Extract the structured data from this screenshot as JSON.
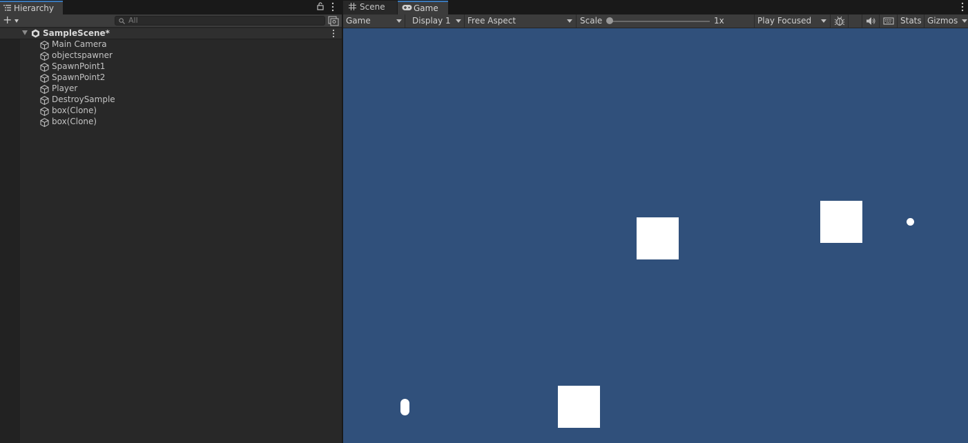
{
  "hierarchy": {
    "tab_label": "Hierarchy",
    "search_placeholder": "All",
    "add_label": "+",
    "scene": {
      "name": "SampleScene*"
    },
    "items": [
      {
        "label": "Main Camera"
      },
      {
        "label": "objectspawner"
      },
      {
        "label": "SpawnPoint1"
      },
      {
        "label": "SpawnPoint2"
      },
      {
        "label": "Player"
      },
      {
        "label": "DestroySample"
      },
      {
        "label": "box(Clone)"
      },
      {
        "label": "box(Clone)"
      }
    ]
  },
  "game": {
    "tabs": [
      {
        "label": "Scene",
        "icon": "grid-icon",
        "active": false
      },
      {
        "label": "Game",
        "icon": "gamepad-icon",
        "active": true
      }
    ],
    "toolbar": {
      "view_select": "Game",
      "display_select": "Display 1",
      "aspect_select": "Free Aspect",
      "scale_label": "Scale",
      "scale_value": "1x",
      "play_mode_select": "Play Focused",
      "stats_label": "Stats",
      "gizmos_label": "Gizmos"
    },
    "background_color": "#30507b",
    "scene_objects": [
      {
        "name": "box",
        "shape": "square"
      },
      {
        "name": "box",
        "shape": "square"
      },
      {
        "name": "box",
        "shape": "square"
      },
      {
        "name": "bullet",
        "shape": "circle"
      },
      {
        "name": "player",
        "shape": "capsule"
      }
    ]
  },
  "colors": {
    "accent": "#3a79bb",
    "panel": "#282828",
    "toolbar": "#3c3c3c"
  }
}
